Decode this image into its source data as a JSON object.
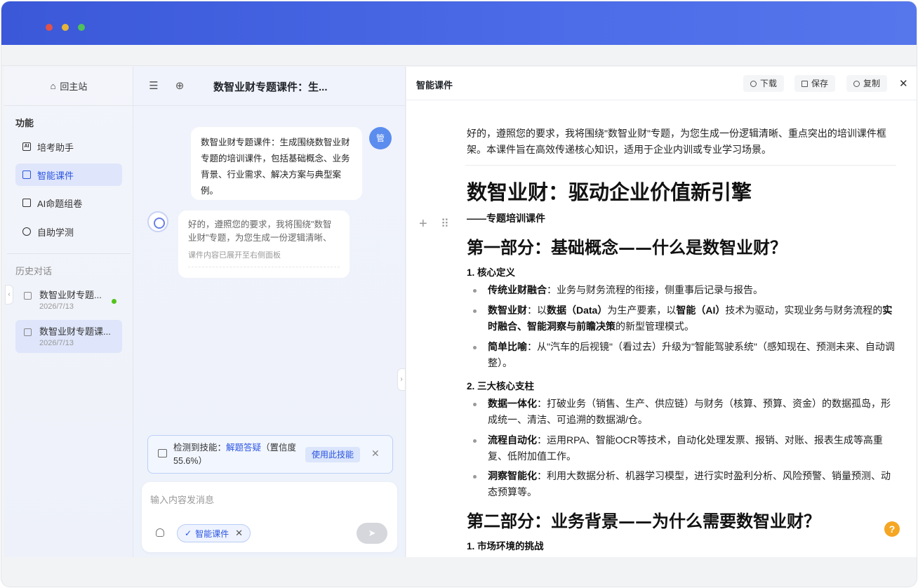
{
  "window": {
    "controls": [
      "close",
      "minimize",
      "maximize"
    ]
  },
  "sidebar": {
    "home_label": "回主站",
    "features_title": "功能",
    "nav": [
      {
        "label": "培考助手",
        "icon": "ai-icon",
        "active": false
      },
      {
        "label": "智能课件",
        "icon": "document-icon",
        "active": true
      },
      {
        "label": "AI命题组卷",
        "icon": "exam-icon",
        "active": false
      },
      {
        "label": "自助学测",
        "icon": "user-test-icon",
        "active": false
      }
    ],
    "history_title": "历史对话",
    "history": [
      {
        "title": "数智业财专题...",
        "date": "2026/7/13",
        "online": true
      },
      {
        "title": "数智业财专题课...",
        "date": "2026/7/13",
        "online": false
      }
    ]
  },
  "chat": {
    "title": "数智业财专题课件：生...",
    "user_avatar_text": "管",
    "user_message": "数智业财专题课件：生成围绕数智业财专题的培训课件，包括基础概念、业务背景、行业需求、解决方案与典型案例。",
    "bot_message": "好的，遵照您的要求，我将围绕\"数智业财\"专题，为您生成一份逻辑清晰、重...",
    "bot_note": "课件内容已展开至右侧面板",
    "skill": {
      "prefix": "检测到技能：",
      "name": "解题答疑",
      "confidence": "（置信度 55.6%）",
      "use_button": "使用此技能"
    },
    "input_placeholder": "输入内容发消息",
    "selected_tag": "智能课件"
  },
  "panel": {
    "title": "智能课件",
    "buttons": {
      "download": "下载",
      "save": "保存",
      "copy": "复制"
    },
    "doc": {
      "intro": "好的，遵照您的要求，我将围绕\"数智业财\"专题，为您生成一份逻辑清晰、重点突出的培训课件框架。本课件旨在高效传递核心知识，适用于企业内训或专业学习场景。",
      "h1": "数智业财：驱动企业价值新引擎",
      "subtitle": "——专题培训课件",
      "part1": "第一部分：基础概念——什么是数智业财？",
      "p1_h3a": "1. 核心定义",
      "p1_items": [
        {
          "term": "传统业财融合",
          "text": "：业务与财务流程的衔接，侧重事后记录与报告。"
        },
        {
          "term": "数智业财",
          "text_parts": [
            "：以",
            "数据（Data）",
            "为生产要素，以",
            "智能（AI）",
            "技术为驱动，实现业务与财务流程的",
            "实时融合、智能洞察与前瞻决策",
            "的新型管理模式。"
          ]
        },
        {
          "term": "简单比喻",
          "text": "：从\"汽车的后视镜\"（看过去）升级为\"智能驾驶系统\"（感知现在、预测未来、自动调整）。"
        }
      ],
      "p1_h3b": "2. 三大核心支柱",
      "p1_pillars": [
        {
          "term": "数据一体化",
          "text": "：打破业务（销售、生产、供应链）与财务（核算、预算、资金）的数据孤岛，形成统一、清洁、可追溯的数据湖/仓。"
        },
        {
          "term": "流程自动化",
          "text": "：运用RPA、智能OCR等技术，自动化处理发票、报销、对账、报表生成等高重复、低附加值工作。"
        },
        {
          "term": "洞察智能化",
          "text": "：利用大数据分析、机器学习模型，进行实时盈利分析、风险预警、销量预测、动态预算等。"
        }
      ],
      "part2": "第二部分：业务背景——为什么需要数智业财？",
      "p2_h3a": "1. 市场环境的挑战"
    }
  },
  "help_label": "?"
}
